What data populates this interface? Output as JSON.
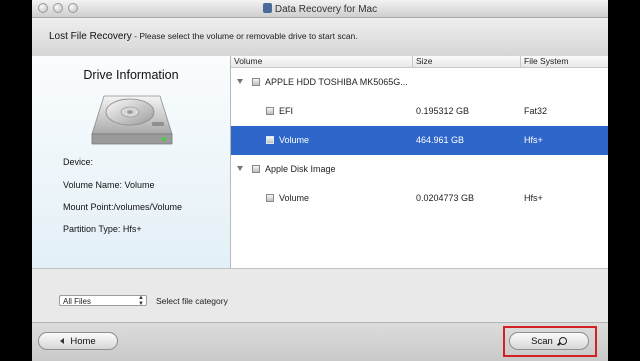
{
  "window": {
    "title": "Data Recovery for Mac"
  },
  "header": {
    "title": "Lost File Recovery",
    "subtitle": " - Please select the volume or removable drive to start scan."
  },
  "drive_info": {
    "title": "Drive Information",
    "device": "Device:",
    "volume_name": "Volume Name: Volume",
    "mount_point": "Mount Point:/volumes/Volume",
    "partition_type": "Partition Type: Hfs+"
  },
  "table": {
    "columns": [
      "Volume",
      "Size",
      "File System"
    ],
    "rows": [
      {
        "kind": "disk",
        "name": "APPLE HDD TOSHIBA MK5065G...",
        "size": "",
        "fs": ""
      },
      {
        "kind": "volume",
        "name": "EFI",
        "size": "0.195312 GB",
        "fs": "Fat32"
      },
      {
        "kind": "volume",
        "name": "Volume",
        "size": "464.961 GB",
        "fs": "Hfs+",
        "selected": true
      },
      {
        "kind": "disk",
        "name": "Apple Disk Image",
        "size": "",
        "fs": ""
      },
      {
        "kind": "volume",
        "name": "Volume",
        "size": "0.0204773 GB",
        "fs": "Hfs+"
      }
    ]
  },
  "filter": {
    "selected": "All Files",
    "label": "Select file category"
  },
  "buttons": {
    "home": "Home",
    "scan": "Scan"
  },
  "colors": {
    "selection": "#2f66c9",
    "highlight_box": "#d42020"
  }
}
